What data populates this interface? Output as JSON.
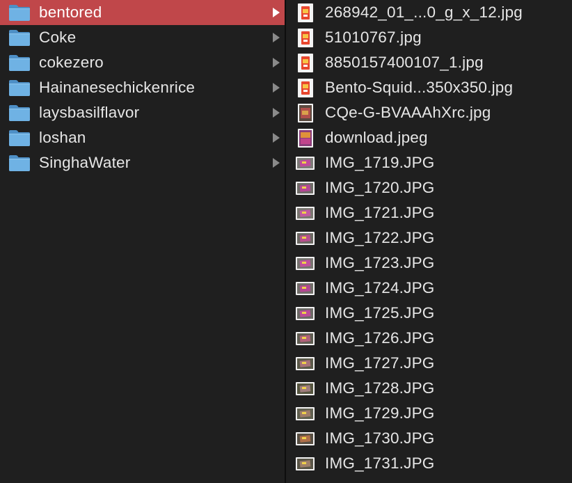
{
  "folders": [
    {
      "label": "bentored",
      "selected": true
    },
    {
      "label": "Coke",
      "selected": false
    },
    {
      "label": "cokezero",
      "selected": false
    },
    {
      "label": "Hainanesechickenrice",
      "selected": false
    },
    {
      "label": "laysbasilflavor",
      "selected": false
    },
    {
      "label": "loshan",
      "selected": false
    },
    {
      "label": "SinghaWater",
      "selected": false
    }
  ],
  "files": [
    {
      "label": "268942_01_...0_g_x_12.jpg",
      "thumb": "product-orange-icon"
    },
    {
      "label": "51010767.jpg",
      "thumb": "product-orange-icon"
    },
    {
      "label": "8850157400107_1.jpg",
      "thumb": "product-orange-icon"
    },
    {
      "label": "Bento-Squid...350x350.jpg",
      "thumb": "product-orange-icon"
    },
    {
      "label": "CQe-G-BVAAAhXrc.jpg",
      "thumb": "photo-dark-icon"
    },
    {
      "label": "download.jpeg",
      "thumb": "product-purple-icon"
    },
    {
      "label": "IMG_1719.JPG",
      "thumb": "photo-landscape-icon"
    },
    {
      "label": "IMG_1720.JPG",
      "thumb": "photo-landscape-icon"
    },
    {
      "label": "IMG_1721.JPG",
      "thumb": "photo-landscape-icon"
    },
    {
      "label": "IMG_1722.JPG",
      "thumb": "photo-landscape-icon"
    },
    {
      "label": "IMG_1723.JPG",
      "thumb": "photo-landscape-icon"
    },
    {
      "label": "IMG_1724.JPG",
      "thumb": "photo-landscape-icon"
    },
    {
      "label": "IMG_1725.JPG",
      "thumb": "photo-landscape-icon"
    },
    {
      "label": "IMG_1726.JPG",
      "thumb": "photo-landscape-icon"
    },
    {
      "label": "IMG_1727.JPG",
      "thumb": "photo-landscape-icon"
    },
    {
      "label": "IMG_1728.JPG",
      "thumb": "photo-landscape-icon"
    },
    {
      "label": "IMG_1729.JPG",
      "thumb": "photo-landscape-icon"
    },
    {
      "label": "IMG_1730.JPG",
      "thumb": "photo-landscape-icon"
    },
    {
      "label": "IMG_1731.JPG",
      "thumb": "photo-landscape-icon"
    }
  ],
  "colors": {
    "background": "#1f1f1f",
    "selection": "#c0474a",
    "folder": "#67a9dd",
    "text": "#e6e6e6"
  }
}
